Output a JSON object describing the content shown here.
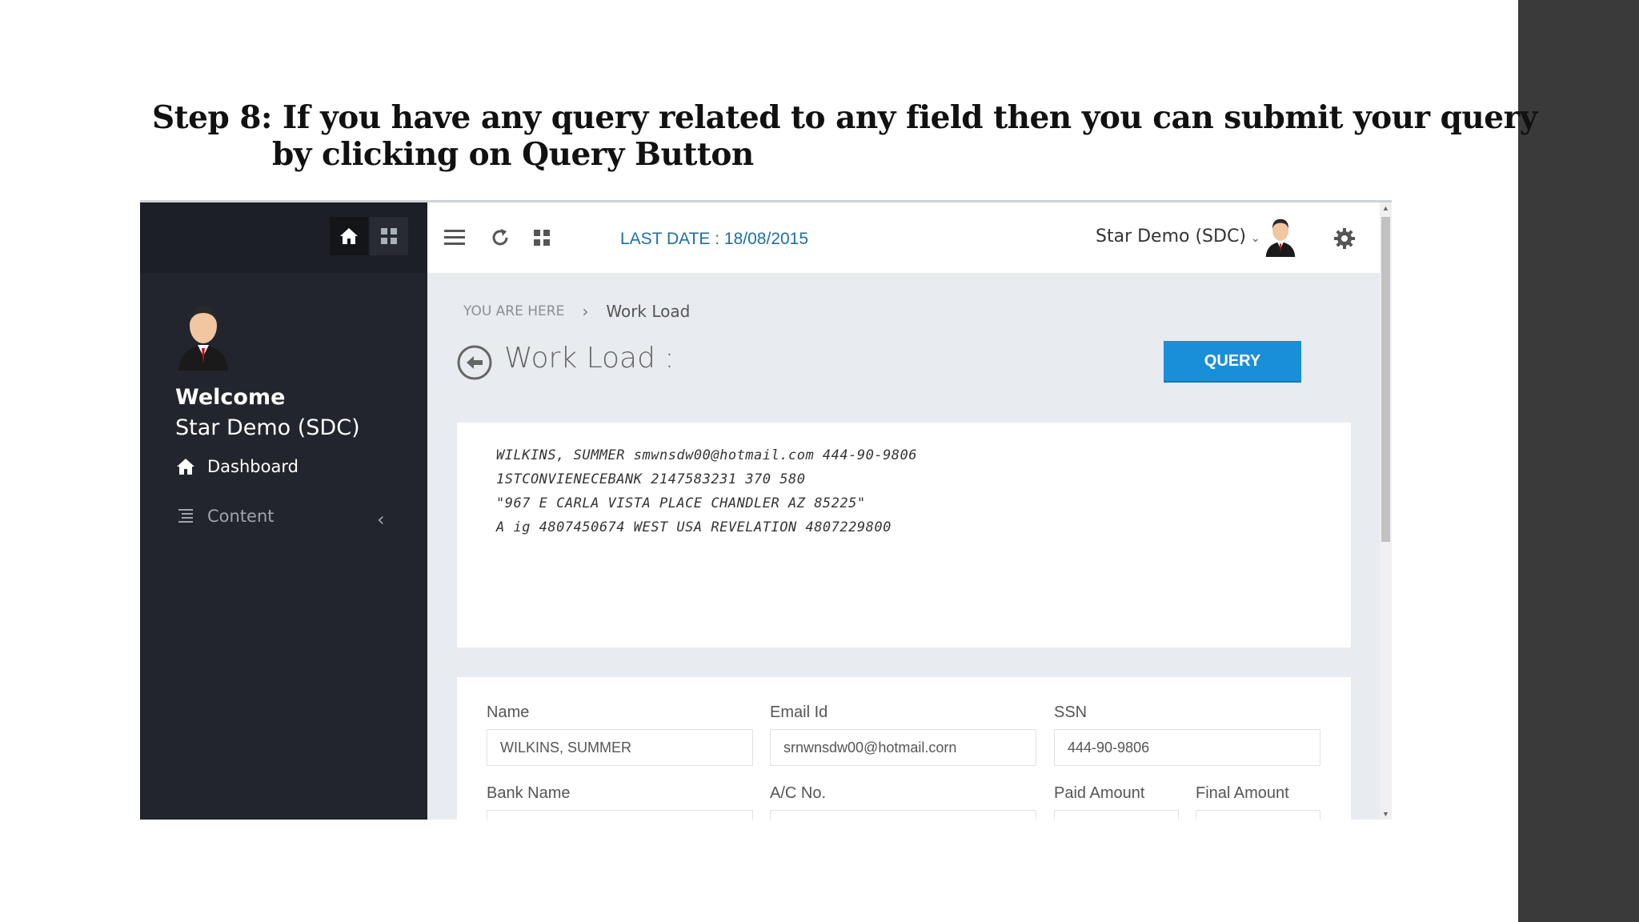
{
  "slide": {
    "title_line1": "Step 8: If you have any query related to any field then you can submit your query",
    "title_line2": "by clicking on Query Button"
  },
  "sidebar": {
    "welcome": "Welcome",
    "user_name": "Star Demo (SDC)",
    "nav": [
      {
        "label": "Dashboard",
        "icon": "home-icon"
      },
      {
        "label": "Content",
        "icon": "list-icon"
      }
    ]
  },
  "topbar": {
    "last_date": "LAST DATE : 18/08/2015",
    "user_name": "Star Demo (SDC)"
  },
  "breadcrumb": {
    "here": "YOU ARE HERE",
    "separator": "›",
    "current": "Work Load"
  },
  "page": {
    "title": "Work Load :",
    "query_button": "QUERY"
  },
  "document_image": {
    "lines": [
      "WILKINS, SUMMER smwnsdw00@hotmail.com 444-90-9806",
      "1STCONVIENECEBANK 2147583231 370 580",
      "\"967 E CARLA VISTA PLACE CHANDLER AZ 85225\"",
      "A ig 4807450674 WEST USA REVELATION 4807229800"
    ]
  },
  "form": {
    "name_label": "Name",
    "name_value": "WILKINS, SUMMER",
    "email_label": "Email Id",
    "email_value": "srnwnsdw00@hotmail.corn",
    "ssn_label": "SSN",
    "ssn_value": "444-90-9806",
    "bank_label": "Bank Name",
    "acno_label": "A/C No.",
    "paid_label": "Paid Amount",
    "final_label": "Final Amount"
  },
  "colors": {
    "sidebar_bg": "#22252d",
    "accent_blue": "#1a8fd9",
    "date_blue": "#1d6fa5"
  }
}
